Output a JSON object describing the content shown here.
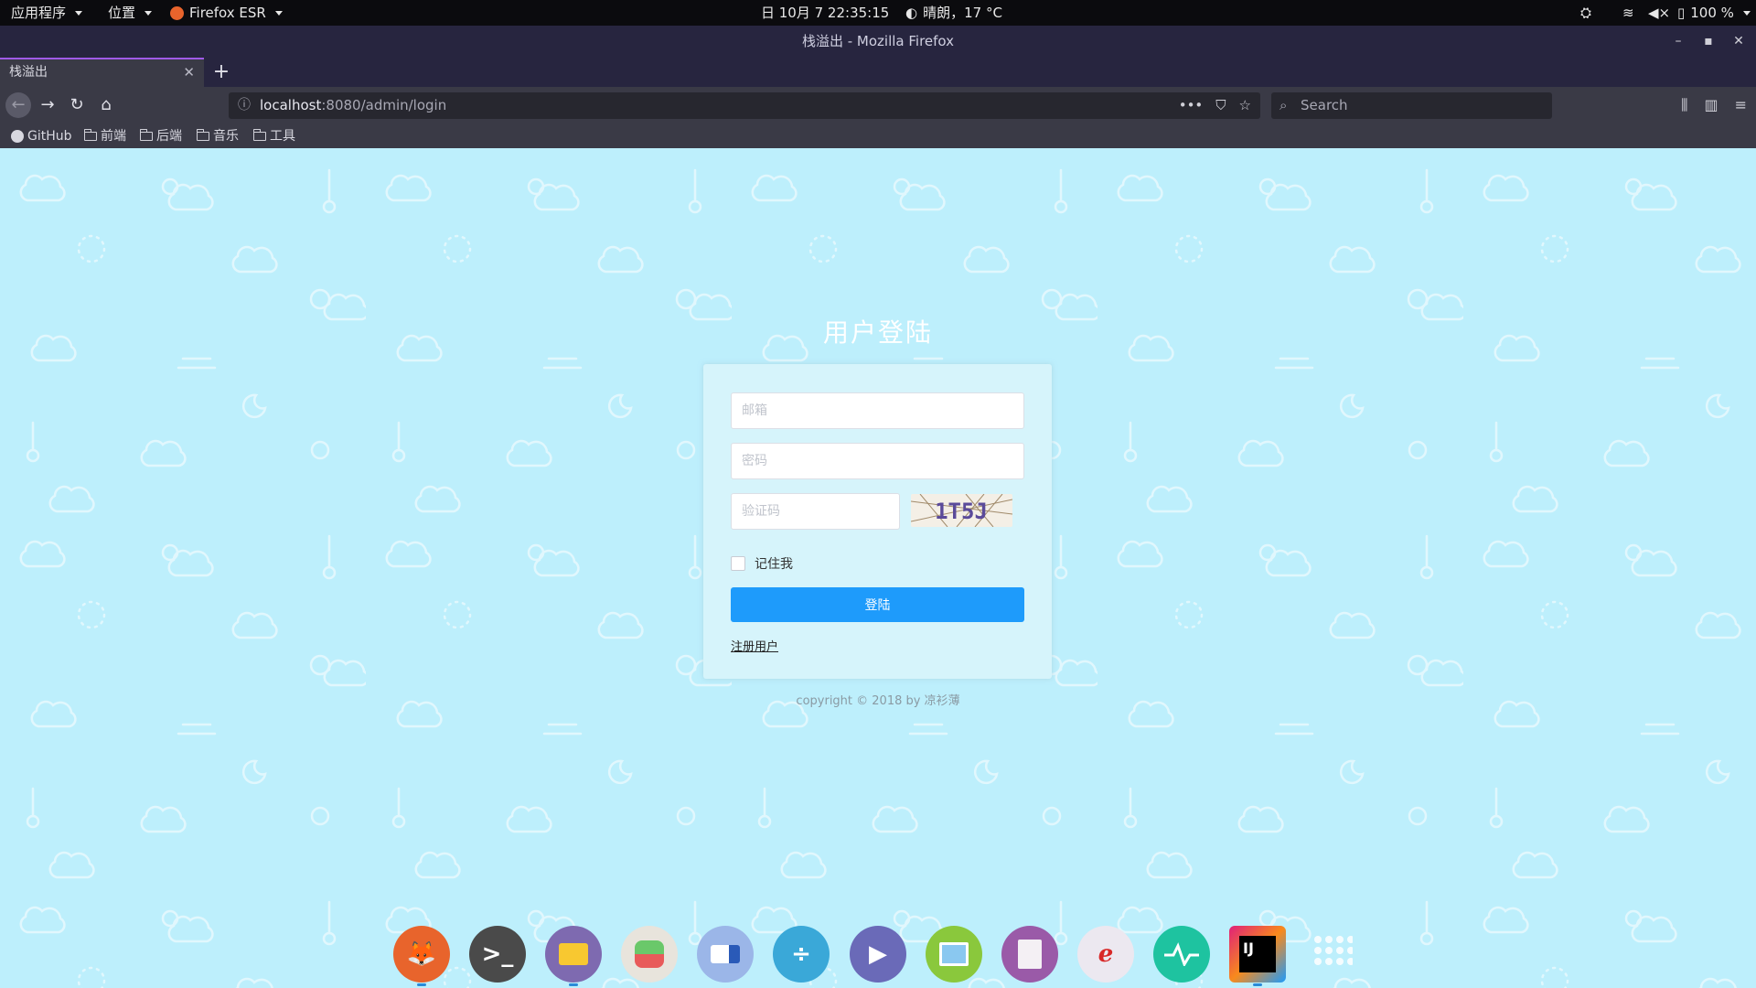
{
  "system_panel": {
    "apps_menu": "应用程序",
    "places_menu": "位置",
    "active_app": "Firefox ESR",
    "datetime": "日 10月 7  22:35:15",
    "weather": "晴朗，17 °C",
    "battery": "100 %"
  },
  "window": {
    "title": "栈溢出 - Mozilla Firefox",
    "tab_title": "栈溢出"
  },
  "navbar": {
    "url_host": "localhost",
    "url_path": ":8080/admin/login",
    "search_placeholder": "Search"
  },
  "bookmarks": [
    {
      "label": "GitHub",
      "icon": "github-icon"
    },
    {
      "label": "前端",
      "icon": "folder-icon"
    },
    {
      "label": "后端",
      "icon": "folder-icon"
    },
    {
      "label": "音乐",
      "icon": "folder-icon"
    },
    {
      "label": "工具",
      "icon": "folder-icon"
    }
  ],
  "login": {
    "title": "用户登陆",
    "email_placeholder": "邮箱",
    "password_placeholder": "密码",
    "captcha_placeholder": "验证码",
    "captcha_text": "1T5J",
    "remember_label": "记住我",
    "submit_label": "登陆",
    "register_link": "注册用户",
    "copyright": "copyright © 2018 by 凉衫薄"
  },
  "dock": [
    {
      "name": "firefox",
      "color": "#e8642c"
    },
    {
      "name": "terminal",
      "color": "#4a4a4a"
    },
    {
      "name": "files",
      "color": "#7e6ab0"
    },
    {
      "name": "settings",
      "color": "#e8e4dc"
    },
    {
      "name": "deepin-manager",
      "color": "#9bb6e8"
    },
    {
      "name": "calculator",
      "color": "#3aa8d8"
    },
    {
      "name": "video-player",
      "color": "#6a6ab8"
    },
    {
      "name": "image-viewer",
      "color": "#8ac83c"
    },
    {
      "name": "text-editor",
      "color": "#9a5aa8"
    },
    {
      "name": "document-signer",
      "color": "#ece8f0"
    },
    {
      "name": "system-monitor",
      "color": "#1ec3a0"
    },
    {
      "name": "intellij-idea",
      "color": "#e0207a"
    },
    {
      "name": "launcher",
      "color": "#ffffff"
    }
  ],
  "colors": {
    "page_bg": "#bdeffc",
    "primary_button": "#1e9bfb",
    "titlebar": "#27253f"
  }
}
